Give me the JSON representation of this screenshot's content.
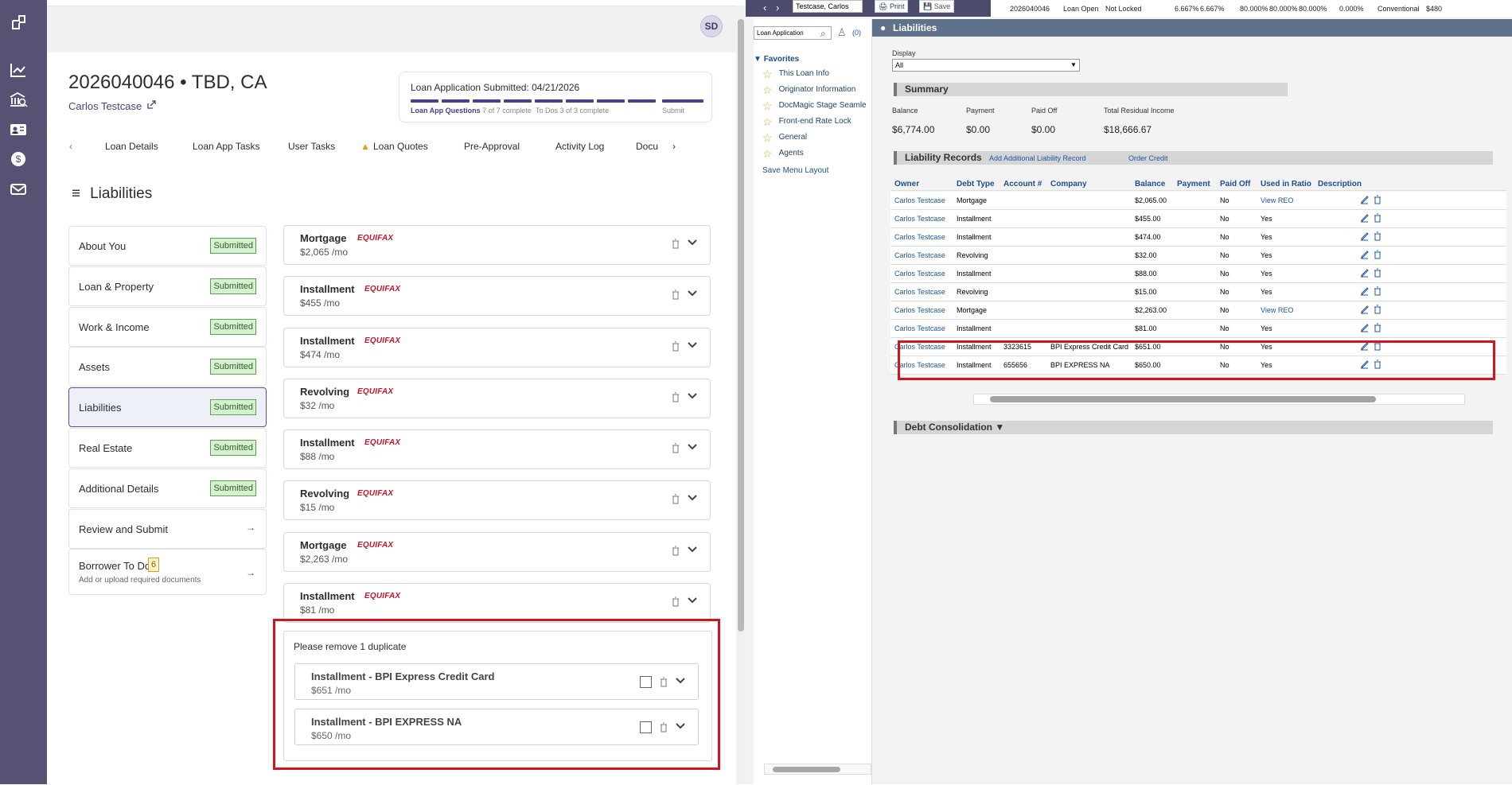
{
  "left": {
    "avatar": "SD",
    "loan_title": "2026040046 • TBD, CA",
    "borrower": "Carlos Testcase",
    "status": {
      "title": "Loan Application Submitted: 04/21/2026",
      "questions_label": "Loan App Questions",
      "questions_count": "7 of 7 complete",
      "todos_label": "To Dos",
      "todos_count": "3 of 3 complete",
      "submit_label": "Submit"
    },
    "tabs": [
      "Loan Details",
      "Loan App Tasks",
      "User Tasks",
      "Loan Quotes",
      "Pre-Approval",
      "Activity Log",
      "Docu"
    ],
    "section_title": "Liabilities",
    "nav": [
      {
        "label": "About You",
        "badge": "Submitted"
      },
      {
        "label": "Loan & Property",
        "badge": "Submitted"
      },
      {
        "label": "Work & Income",
        "badge": "Submitted"
      },
      {
        "label": "Assets",
        "badge": "Submitted"
      },
      {
        "label": "Liabilities",
        "badge": "Submitted"
      },
      {
        "label": "Real Estate",
        "badge": "Submitted"
      },
      {
        "label": "Additional Details",
        "badge": "Submitted"
      },
      {
        "label": "Review and Submit",
        "badge": "→"
      },
      {
        "label": "Borrower To Dos",
        "badge": "6",
        "subtext": "Add or upload required documents"
      }
    ],
    "debts": [
      {
        "type": "Mortgage",
        "bureau": "EQUIFAX",
        "amount": "$2,065 /mo"
      },
      {
        "type": "Installment",
        "bureau": "EQUIFAX",
        "amount": "$455 /mo"
      },
      {
        "type": "Installment",
        "bureau": "EQUIFAX",
        "amount": "$474 /mo"
      },
      {
        "type": "Revolving",
        "bureau": "EQUIFAX",
        "amount": "$32 /mo"
      },
      {
        "type": "Installment",
        "bureau": "EQUIFAX",
        "amount": "$88 /mo"
      },
      {
        "type": "Revolving",
        "bureau": "EQUIFAX",
        "amount": "$15 /mo"
      },
      {
        "type": "Mortgage",
        "bureau": "EQUIFAX",
        "amount": "$2,263 /mo"
      },
      {
        "type": "Installment",
        "bureau": "EQUIFAX",
        "amount": "$81 /mo"
      }
    ],
    "duplicate": {
      "title": "Please remove 1 duplicate",
      "items": [
        {
          "type": "Installment - BPI Express Credit Card",
          "amount": "$651 /mo"
        },
        {
          "type": "Installment - BPI EXPRESS NA",
          "amount": "$650 /mo"
        }
      ]
    }
  },
  "right": {
    "top": {
      "borrower_select": "Testcase, Carlos",
      "print": "Print",
      "save": "Save",
      "loan_no": "2026040046",
      "status": "Loan Open",
      "lock": "Not Locked",
      "rate1": "6.667%",
      "rate2": "6.667%",
      "ltv1": "80.000%",
      "ltv2": "80.000%",
      "ltv3": "80.000%",
      "zero": "0.000%",
      "product": "Conventional",
      "amount": "$480"
    },
    "side": {
      "search_placeholder": "Loan Application",
      "count": "(0)",
      "favorites": "Favorites",
      "items": [
        "This Loan Info",
        "Originator Information",
        "DocMagic Stage Seamle",
        "Front-end Rate Lock",
        "General",
        "Agents"
      ],
      "save_layout": "Save Menu Layout"
    },
    "main": {
      "title": "Liabilities",
      "display_label": "Display",
      "display_value": "All",
      "summary": "Summary",
      "summary_labels": [
        "Balance",
        "Payment",
        "Paid Off",
        "Total Residual Income"
      ],
      "summary_values": [
        "$6,774.00",
        "$0.00",
        "$0.00",
        "$18,666.67"
      ],
      "records": "Liability Records",
      "add_record": "Add Additional Liability Record",
      "order_credit": "Order Credit",
      "headers": [
        "Owner",
        "Debt Type",
        "Account #",
        "Company",
        "Balance",
        "Payment",
        "Paid Off",
        "Used in Ratio",
        "Description"
      ],
      "rows": [
        [
          "Carlos Testcase",
          "Mortgage",
          "",
          "",
          "$2,065.00",
          "",
          "No",
          "View REO",
          ""
        ],
        [
          "Carlos Testcase",
          "Installment",
          "",
          "",
          "$455.00",
          "",
          "No",
          "Yes",
          ""
        ],
        [
          "Carlos Testcase",
          "Installment",
          "",
          "",
          "$474.00",
          "",
          "No",
          "Yes",
          ""
        ],
        [
          "Carlos Testcase",
          "Revolving",
          "",
          "",
          "$32.00",
          "",
          "No",
          "Yes",
          ""
        ],
        [
          "Carlos Testcase",
          "Installment",
          "",
          "",
          "$88.00",
          "",
          "No",
          "Yes",
          ""
        ],
        [
          "Carlos Testcase",
          "Revolving",
          "",
          "",
          "$15.00",
          "",
          "No",
          "Yes",
          ""
        ],
        [
          "Carlos Testcase",
          "Mortgage",
          "",
          "",
          "$2,263.00",
          "",
          "No",
          "View REO",
          ""
        ],
        [
          "Carlos Testcase",
          "Installment",
          "",
          "",
          "$81.00",
          "",
          "No",
          "Yes",
          ""
        ],
        [
          "Carlos Testcase",
          "Installment",
          "3323615",
          "BPI Express Credit Card",
          "$651.00",
          "",
          "No",
          "Yes",
          ""
        ],
        [
          "Carlos Testcase",
          "Installment",
          "655656",
          "BPI EXPRESS NA",
          "$650.00",
          "",
          "No",
          "Yes",
          ""
        ]
      ],
      "debt_consolidation": "Debt Consolidation"
    }
  },
  "colors": {
    "rail": "#575173",
    "accent": "#4b3d91",
    "highlight": "#d4141c",
    "equifax": "#c6162d"
  }
}
